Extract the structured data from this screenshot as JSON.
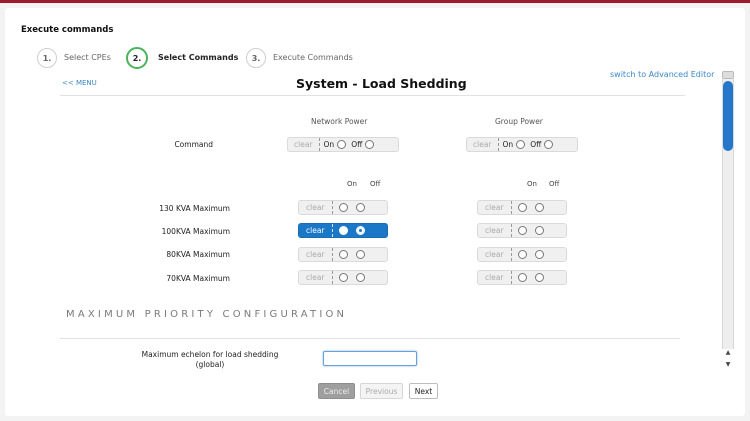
{
  "window": {
    "title": "Execute commands"
  },
  "steps": [
    {
      "num": "1.",
      "label": "Select CPEs",
      "active": false
    },
    {
      "num": "2.",
      "label": "Select Commands",
      "active": true
    },
    {
      "num": "3.",
      "label": "Execute Commands",
      "active": false
    }
  ],
  "nav": {
    "menu_link": "<< MENU",
    "advanced_link": "switch to Advanced Editor"
  },
  "page": {
    "title": "System - Load Shedding"
  },
  "columns": {
    "network": "Network Power",
    "group": "Group Power"
  },
  "command_row": {
    "label": "Command",
    "clear": "clear",
    "on": "On",
    "off": "Off"
  },
  "onoff_header": {
    "on": "On",
    "off": "Off"
  },
  "rows": [
    {
      "label": "130 KVA Maximum",
      "clear": "clear",
      "network_selected": "none",
      "group_selected": "none"
    },
    {
      "label": "100KVA Maximum",
      "clear": "clear",
      "network_selected": "off",
      "group_selected": "none"
    },
    {
      "label": "80KVA Maximum",
      "clear": "clear",
      "network_selected": "none",
      "group_selected": "none"
    },
    {
      "label": "70KVA Maximum",
      "clear": "clear",
      "network_selected": "none",
      "group_selected": "none"
    }
  ],
  "section": {
    "title": "MAXIMUM PRIORITY CONFIGURATION"
  },
  "field": {
    "label_line1": "Maximum echelon for load shedding",
    "label_line2": "(global)",
    "value": ""
  },
  "buttons": {
    "cancel": "Cancel",
    "previous": "Previous",
    "next": "Next"
  },
  "colors": {
    "accent": "#1a78c7",
    "step_active": "#4bb35c",
    "top_bar": "#9c1b2e"
  }
}
